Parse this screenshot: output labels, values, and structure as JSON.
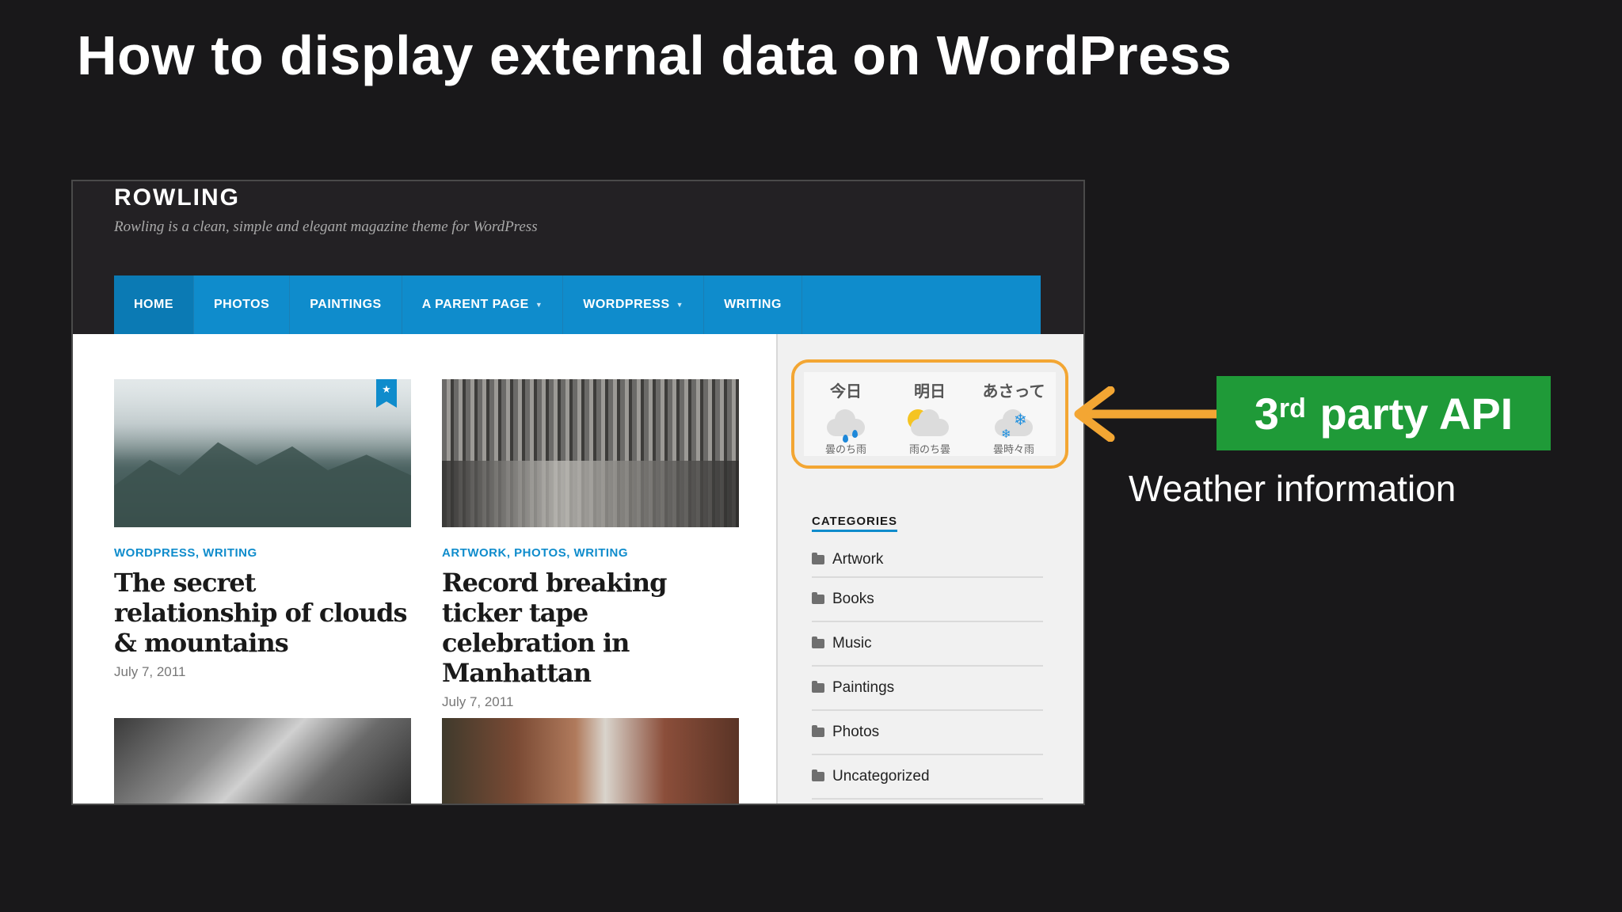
{
  "slide": {
    "title": "How to display external data on WordPress"
  },
  "site": {
    "title": "ROWLING",
    "tagline": "Rowling is a clean, simple and elegant magazine theme for WordPress"
  },
  "nav": {
    "items": [
      {
        "label": "HOME"
      },
      {
        "label": "PHOTOS"
      },
      {
        "label": "PAINTINGS"
      },
      {
        "label": "A PARENT PAGE"
      },
      {
        "label": "WORDPRESS"
      },
      {
        "label": "WRITING"
      }
    ]
  },
  "posts": [
    {
      "categories": "WORDPRESS, WRITING",
      "title": "The secret relationship of clouds & mountains",
      "date": "July 7, 2011"
    },
    {
      "categories": "ARTWORK, PHOTOS, WRITING",
      "title": "Record breaking ticker tape celebration in Manhattan",
      "date": "July 7, 2011"
    }
  ],
  "weather": {
    "days": [
      {
        "label": "今日",
        "desc": "曇のち雨",
        "icon": "cloud-rain-icon"
      },
      {
        "label": "明日",
        "desc": "雨のち曇",
        "icon": "sun-cloud-icon"
      },
      {
        "label": "あさって",
        "desc": "曇時々雨",
        "icon": "snow-icon"
      }
    ]
  },
  "sidebar": {
    "categories_heading": "CATEGORIES",
    "categories": [
      {
        "label": "Artwork"
      },
      {
        "label": "Books"
      },
      {
        "label": "Music"
      },
      {
        "label": "Paintings"
      },
      {
        "label": "Photos"
      },
      {
        "label": "Uncategorized"
      }
    ]
  },
  "callout": {
    "api_ordinal": "3",
    "api_suffix": "rd",
    "api_text": " party API",
    "caption": "Weather information",
    "arrow_color": "#f3a633",
    "box_color": "#1f9a38"
  }
}
